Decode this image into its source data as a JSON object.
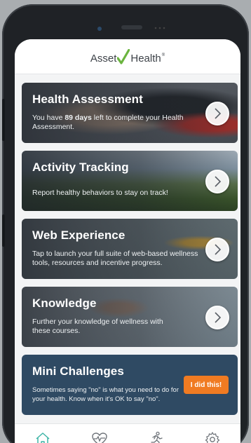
{
  "app": {
    "logo_left": "Asset",
    "logo_right": "Health",
    "logo_mark": "®"
  },
  "cards": [
    {
      "title": "Health Assessment",
      "desc_prefix": "You have ",
      "desc_bold": "89 days",
      "desc_suffix": " left to complete your Health Assessment.",
      "action_icon": "chevron-right-icon"
    },
    {
      "title": "Activity Tracking",
      "desc": "Report healthy behaviors to stay on track!",
      "action_icon": "chevron-right-icon"
    },
    {
      "title": "Web Experience",
      "desc": "Tap to launch your full suite of web-based wellness tools, resources and incentive progress.",
      "action_icon": "chevron-right-icon"
    },
    {
      "title": "Knowledge",
      "desc": "Further your knowledge of wellness with these courses.",
      "action_icon": "chevron-right-icon"
    },
    {
      "title": "Mini Challenges",
      "desc": "Sometimes saying \"no\" is what you need to do for your health. Know when it's OK to say \"no\".",
      "button_label": "I did this!"
    }
  ],
  "tabs": [
    {
      "icon": "home-icon",
      "active": true
    },
    {
      "icon": "heart-pulse-icon",
      "active": false
    },
    {
      "icon": "runner-icon",
      "active": false
    },
    {
      "icon": "gear-icon",
      "active": false
    }
  ],
  "colors": {
    "accent_green": "#6bb43f",
    "challenge_bg": "#2f4a63",
    "button_orange": "#f07b22",
    "active_tab": "#3fb5a7",
    "inactive_tab": "#6d7278"
  }
}
